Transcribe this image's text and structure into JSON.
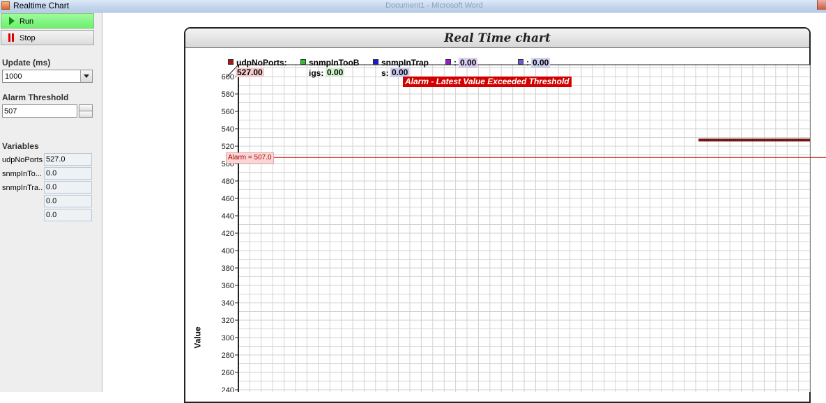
{
  "window": {
    "title": "Realtime Chart",
    "background_title": "Document1 - Microsoft Word"
  },
  "sidebar": {
    "run_label": "Run",
    "stop_label": "Stop",
    "update_label": "Update (ms)",
    "update_value": "1000",
    "alarm_label": "Alarm Threshold",
    "alarm_value": "507",
    "variables_label": "Variables",
    "variables": [
      {
        "name": "udpNoPorts",
        "value": "527.0"
      },
      {
        "name": "snmpInTo...",
        "value": "0.0"
      },
      {
        "name": "snmpInTra...",
        "value": "0.0"
      },
      {
        "name": "",
        "value": "0.0"
      },
      {
        "name": "",
        "value": "0.0"
      }
    ]
  },
  "chart": {
    "title": "Real Time chart",
    "alarm_message": "Alarm - Latest Value Exceeded Threshold",
    "alarm_marker_label": "Alarm = 507.0",
    "legend": [
      {
        "name": "udpNoPorts:",
        "value": "527.00",
        "color": "#b21414",
        "value_bg": "#f7cccc"
      },
      {
        "name": "snmpInTooB",
        "name2": "igs:",
        "value": "0.00",
        "color": "#2fbf2f",
        "value_bg": "#d2f2d2"
      },
      {
        "name": "snmpInTrap",
        "name2": "s:",
        "value": "0.00",
        "color": "#1a1ad6",
        "value_bg": "#ccccf0"
      },
      {
        "name": ":",
        "value": "0.00",
        "color": "#9a1ad6",
        "value_bg": "#d8ccf0"
      },
      {
        "name": ":",
        "value": "0.00",
        "color": "#6a5ad6",
        "value_bg": "#d0d0f0"
      }
    ]
  },
  "chart_data": {
    "type": "line",
    "title": "Real Time chart",
    "ylabel": "Value",
    "xlabel": "",
    "ylim": [
      240,
      600
    ],
    "yticks": [
      600,
      580,
      560,
      540,
      520,
      500,
      480,
      460,
      440,
      420,
      400,
      380,
      360,
      340,
      320,
      300,
      280,
      260,
      240
    ],
    "grid": true,
    "legend_position": "top",
    "threshold": 507,
    "series": [
      {
        "name": "udpNoPorts",
        "color": "#b21414",
        "points_value": 527,
        "visible_start_fraction": 0.805
      }
    ]
  }
}
